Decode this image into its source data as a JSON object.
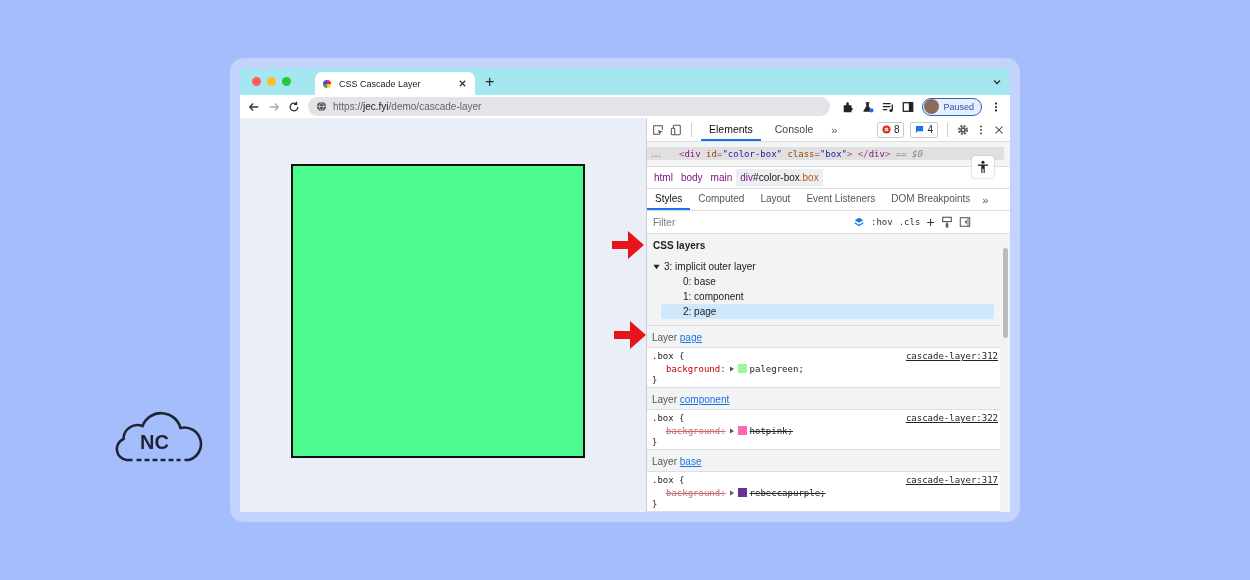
{
  "browser": {
    "tab": {
      "title": "CSS Cascade Layer"
    },
    "new_tab": "+",
    "url": {
      "scheme": "https://",
      "host": "jec.fyi",
      "path": "/demo/cascade-layer"
    },
    "profile": {
      "status": "Paused"
    }
  },
  "devtools": {
    "tabs": [
      {
        "label": "Elements",
        "selected": true
      },
      {
        "label": "Console",
        "selected": false
      }
    ],
    "more_tabs": "»",
    "errors": "8",
    "messages": "4",
    "dom_line": {
      "dots": "…",
      "segments": [
        {
          "kind": "punct",
          "text": "<"
        },
        {
          "kind": "tag",
          "text": "div"
        },
        {
          "kind": "attr",
          "text": " id"
        },
        {
          "kind": "punct",
          "text": "="
        },
        {
          "kind": "value",
          "text": "\"color-box\""
        },
        {
          "kind": "attr",
          "text": " class"
        },
        {
          "kind": "punct",
          "text": "="
        },
        {
          "kind": "value",
          "text": "\"box\""
        },
        {
          "kind": "punct",
          "text": ">"
        },
        {
          "kind": "punct",
          "text": " </"
        },
        {
          "kind": "tag",
          "text": "div"
        },
        {
          "kind": "punct",
          "text": ">"
        },
        {
          "kind": "marker",
          "text": " == $0"
        }
      ]
    },
    "breadcrumbs": [
      {
        "parts": [
          {
            "kind": "tag",
            "text": "html"
          }
        ],
        "selected": false
      },
      {
        "parts": [
          {
            "kind": "tag",
            "text": "body"
          }
        ],
        "selected": false
      },
      {
        "parts": [
          {
            "kind": "tag",
            "text": "main"
          }
        ],
        "selected": false
      },
      {
        "parts": [
          {
            "kind": "tag",
            "text": "div"
          },
          {
            "kind": "id",
            "text": "#color-box"
          },
          {
            "kind": "class",
            "text": ".box"
          }
        ],
        "selected": true
      }
    ],
    "style_tabs": [
      {
        "label": "Styles",
        "selected": true
      },
      {
        "label": "Computed",
        "selected": false
      },
      {
        "label": "Layout",
        "selected": false
      },
      {
        "label": "Event Listeners",
        "selected": false
      },
      {
        "label": "DOM Breakpoints",
        "selected": false
      }
    ],
    "more_style_tabs": "»",
    "filter": {
      "placeholder": "Filter"
    },
    "hov": ":hov",
    "cls": ".cls",
    "add": "+",
    "layers": {
      "heading": "CSS layers",
      "tree": [
        {
          "label": "3: implicit outer layer",
          "expanded": true,
          "selected": false,
          "children": [
            {
              "label": "0: base",
              "selected": false
            },
            {
              "label": "1: component",
              "selected": false
            },
            {
              "label": "2: page",
              "selected": true
            }
          ]
        }
      ]
    },
    "rules": [
      {
        "layer_label": "Layer",
        "layer": "page",
        "selector": ".box {",
        "source": "cascade-layer:312",
        "property": "background:",
        "value": "palegreen;",
        "color": "#98fb98",
        "overridden": false,
        "close": "}"
      },
      {
        "layer_label": "Layer",
        "layer": "component",
        "selector": ".box {",
        "source": "cascade-layer:322",
        "property": "background:",
        "value": "hotpink;",
        "color": "#ff69b4",
        "overridden": true,
        "close": "}"
      },
      {
        "layer_label": "Layer",
        "layer": "base",
        "selector": ".box {",
        "source": "cascade-layer:317",
        "property": "background:",
        "value": "rebeccapurple;",
        "color": "#663399",
        "overridden": true,
        "close": "}"
      }
    ]
  },
  "logo": {
    "text": "NC"
  }
}
